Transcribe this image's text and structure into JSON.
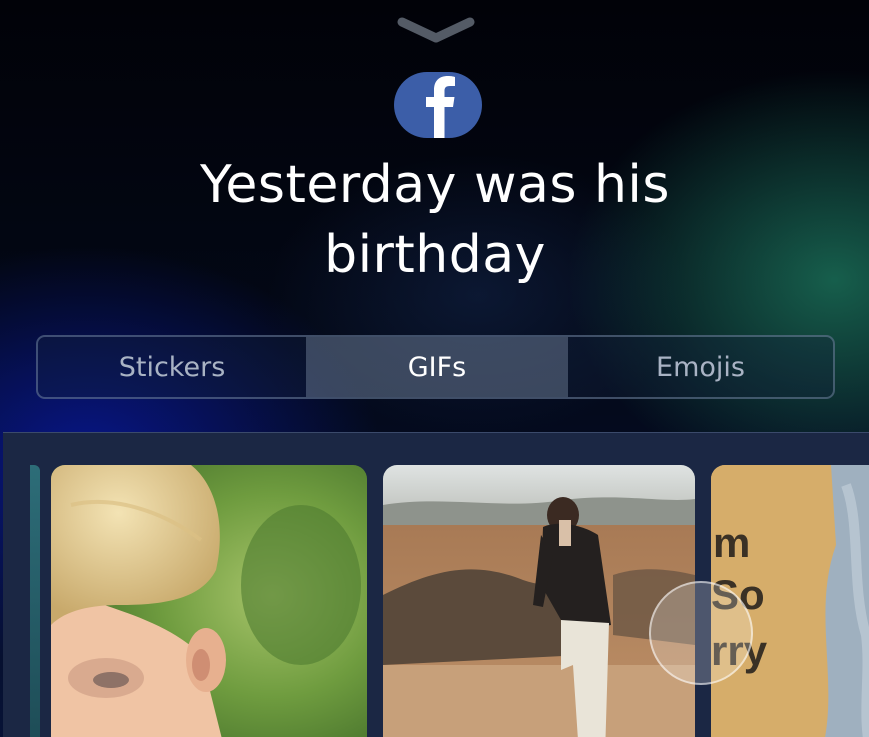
{
  "header": {
    "dismiss_icon": "chevron-down-icon",
    "app_icon": "facebook-icon",
    "app_icon_letter": "f",
    "title": "Yesterday was his birthday"
  },
  "tabs": [
    {
      "label": "Stickers",
      "selected": false
    },
    {
      "label": "GIFs",
      "selected": true
    },
    {
      "label": "Emojis",
      "selected": false
    }
  ],
  "gif_text": "m So rry",
  "colors": {
    "facebook_blue": "#3c5ea8",
    "selected_tab": "#6c7a92",
    "tray": "#1b2744"
  }
}
